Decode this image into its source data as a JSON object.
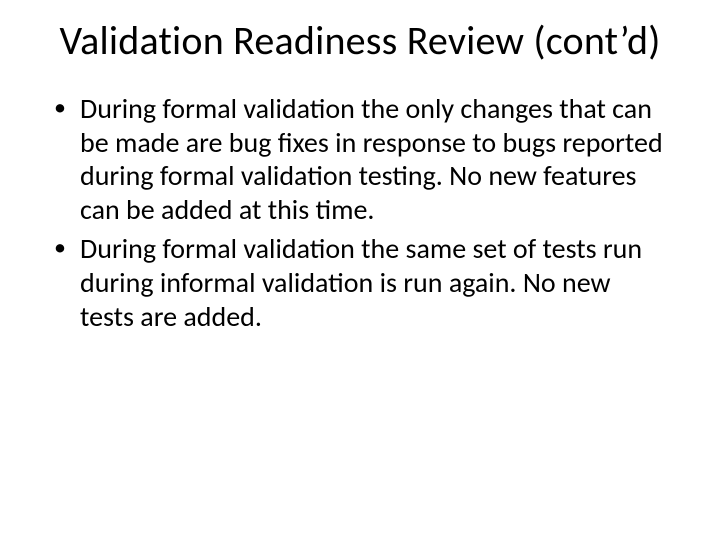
{
  "title": "Validation Readiness Review (cont’d)",
  "bullets": [
    "During formal validation the only changes that can be made are bug fixes in response to bugs reported during formal validation testing. No new features can be added at this time.",
    "During formal validation the same set of tests run during informal validation is run again.  No new tests are added."
  ]
}
